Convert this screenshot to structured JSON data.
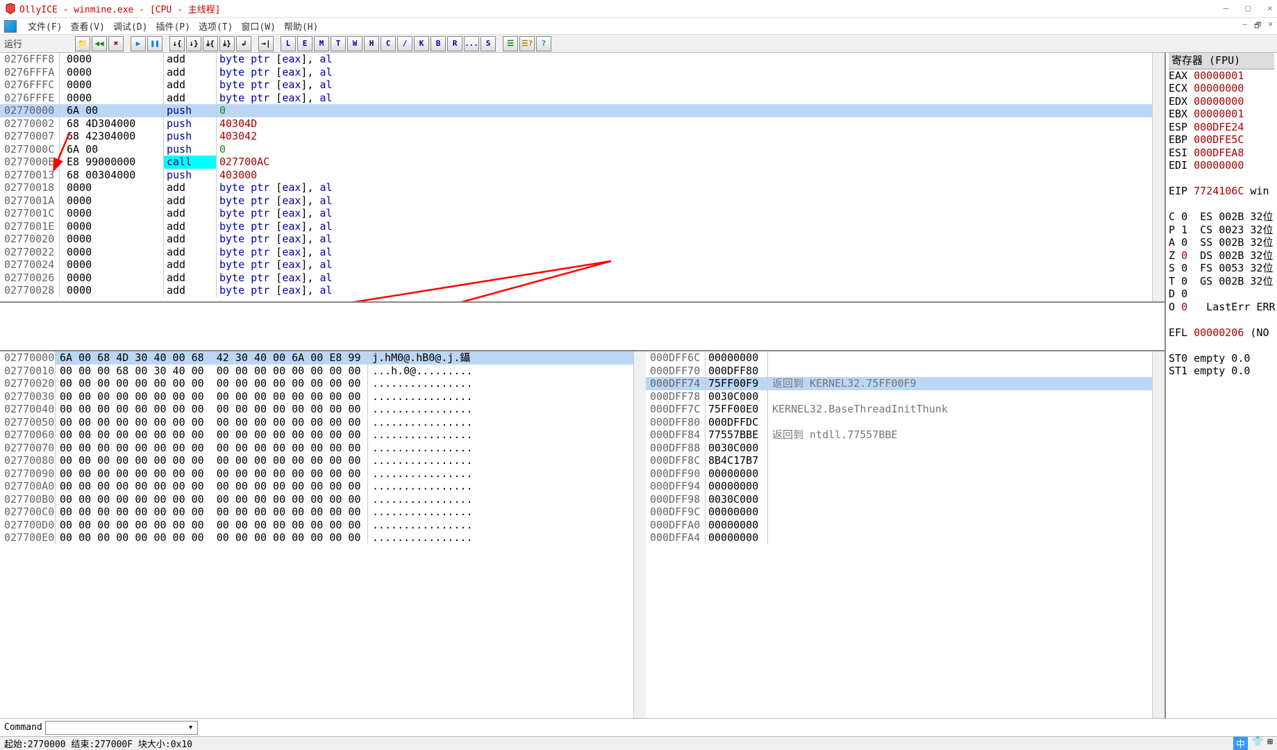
{
  "window": {
    "title": "OllyICE - winmine.exe - [CPU - 主线程]"
  },
  "menus": [
    "文件(F)",
    "查看(V)",
    "调试(D)",
    "插件(P)",
    "选项(T)",
    "窗口(W)",
    "帮助(H)"
  ],
  "run_label": "运行",
  "tool_letters": [
    "L",
    "E",
    "M",
    "T",
    "W",
    "H",
    "C",
    "/",
    "K",
    "B",
    "R",
    "...",
    "S"
  ],
  "cpu_rows": [
    {
      "addr": "0276FFF8",
      "hex": "0000",
      "mnem": "add",
      "mclass": "",
      "op": "byte ptr [eax], al"
    },
    {
      "addr": "0276FFFA",
      "hex": "0000",
      "mnem": "add",
      "mclass": "",
      "op": "byte ptr [eax], al"
    },
    {
      "addr": "0276FFFC",
      "hex": "0000",
      "mnem": "add",
      "mclass": "",
      "op": "byte ptr [eax], al"
    },
    {
      "addr": "0276FFFE",
      "hex": "0000",
      "mnem": "add",
      "mclass": "",
      "op": "byte ptr [eax], al"
    },
    {
      "addr": "02770000",
      "hex": "6A 00",
      "mnem": "push",
      "mclass": "mblue",
      "op": "0",
      "sel": true,
      "opclass": "op-green"
    },
    {
      "addr": "02770002",
      "hex": "68 4D304000",
      "mnem": "push",
      "mclass": "mblue",
      "op": "40304D",
      "opclass": "op-red"
    },
    {
      "addr": "02770007",
      "hex": "68 42304000",
      "mnem": "push",
      "mclass": "mblue",
      "op": "403042",
      "opclass": "op-red"
    },
    {
      "addr": "0277000C",
      "hex": "6A 00",
      "mnem": "push",
      "mclass": "mblue",
      "op": "0",
      "opclass": "op-green"
    },
    {
      "addr": "0277000E",
      "hex": "E8 99000000",
      "mnem": "call",
      "mclass": "mcall",
      "op": "027700AC",
      "opclass": "op-red"
    },
    {
      "addr": "02770013",
      "hex": "68 00304000",
      "mnem": "push",
      "mclass": "mblue",
      "op": "403000",
      "opclass": "op-red"
    },
    {
      "addr": "02770018",
      "hex": "0000",
      "mnem": "add",
      "mclass": "",
      "op": "byte ptr [eax], al"
    },
    {
      "addr": "0277001A",
      "hex": "0000",
      "mnem": "add",
      "mclass": "",
      "op": "byte ptr [eax], al"
    },
    {
      "addr": "0277001C",
      "hex": "0000",
      "mnem": "add",
      "mclass": "",
      "op": "byte ptr [eax], al"
    },
    {
      "addr": "0277001E",
      "hex": "0000",
      "mnem": "add",
      "mclass": "",
      "op": "byte ptr [eax], al"
    },
    {
      "addr": "02770020",
      "hex": "0000",
      "mnem": "add",
      "mclass": "",
      "op": "byte ptr [eax], al"
    },
    {
      "addr": "02770022",
      "hex": "0000",
      "mnem": "add",
      "mclass": "",
      "op": "byte ptr [eax], al"
    },
    {
      "addr": "02770024",
      "hex": "0000",
      "mnem": "add",
      "mclass": "",
      "op": "byte ptr [eax], al"
    },
    {
      "addr": "02770026",
      "hex": "0000",
      "mnem": "add",
      "mclass": "",
      "op": "byte ptr [eax], al"
    },
    {
      "addr": "02770028",
      "hex": "0000",
      "mnem": "add",
      "mclass": "",
      "op": "byte ptr [eax], al"
    }
  ],
  "dump_rows": [
    {
      "addr": "02770000",
      "hex": "6A 00 68 4D 30 40 00 68  42 30 40 00 6A 00 E8 99",
      "asc": "j.hM0@.hB0@.j.鑷",
      "sel": true
    },
    {
      "addr": "02770010",
      "hex": "00 00 00 68 00 30 40 00  00 00 00 00 00 00 00 00",
      "asc": "...h.0@........."
    },
    {
      "addr": "02770020",
      "hex": "00 00 00 00 00 00 00 00  00 00 00 00 00 00 00 00",
      "asc": "................"
    },
    {
      "addr": "02770030",
      "hex": "00 00 00 00 00 00 00 00  00 00 00 00 00 00 00 00",
      "asc": "................"
    },
    {
      "addr": "02770040",
      "hex": "00 00 00 00 00 00 00 00  00 00 00 00 00 00 00 00",
      "asc": "................"
    },
    {
      "addr": "02770050",
      "hex": "00 00 00 00 00 00 00 00  00 00 00 00 00 00 00 00",
      "asc": "................"
    },
    {
      "addr": "02770060",
      "hex": "00 00 00 00 00 00 00 00  00 00 00 00 00 00 00 00",
      "asc": "................"
    },
    {
      "addr": "02770070",
      "hex": "00 00 00 00 00 00 00 00  00 00 00 00 00 00 00 00",
      "asc": "................"
    },
    {
      "addr": "02770080",
      "hex": "00 00 00 00 00 00 00 00  00 00 00 00 00 00 00 00",
      "asc": "................"
    },
    {
      "addr": "02770090",
      "hex": "00 00 00 00 00 00 00 00  00 00 00 00 00 00 00 00",
      "asc": "................"
    },
    {
      "addr": "027700A0",
      "hex": "00 00 00 00 00 00 00 00  00 00 00 00 00 00 00 00",
      "asc": "................"
    },
    {
      "addr": "027700B0",
      "hex": "00 00 00 00 00 00 00 00  00 00 00 00 00 00 00 00",
      "asc": "................"
    },
    {
      "addr": "027700C0",
      "hex": "00 00 00 00 00 00 00 00  00 00 00 00 00 00 00 00",
      "asc": "................"
    },
    {
      "addr": "027700D0",
      "hex": "00 00 00 00 00 00 00 00  00 00 00 00 00 00 00 00",
      "asc": "................"
    },
    {
      "addr": "027700E0",
      "hex": "00 00 00 00 00 00 00 00  00 00 00 00 00 00 00 00",
      "asc": "................"
    }
  ],
  "stack_rows": [
    {
      "addr": "000DFF6C",
      "val": "00000000",
      "info": ""
    },
    {
      "addr": "000DFF70",
      "val": "000DFF80",
      "info": ""
    },
    {
      "addr": "000DFF74",
      "val": "75FF00F9",
      "info": "返回到 KERNEL32.75FF00F9",
      "sel": true
    },
    {
      "addr": "000DFF78",
      "val": "0030C000",
      "info": ""
    },
    {
      "addr": "000DFF7C",
      "val": "75FF00E0",
      "info": "KERNEL32.BaseThreadInitThunk"
    },
    {
      "addr": "000DFF80",
      "val": "000DFFDC",
      "info": ""
    },
    {
      "addr": "000DFF84",
      "val": "77557BBE",
      "info": "返回到 ntdll.77557BBE"
    },
    {
      "addr": "000DFF88",
      "val": "0030C000",
      "info": ""
    },
    {
      "addr": "000DFF8C",
      "val": "8B4C17B7",
      "info": ""
    },
    {
      "addr": "000DFF90",
      "val": "00000000",
      "info": ""
    },
    {
      "addr": "000DFF94",
      "val": "00000000",
      "info": ""
    },
    {
      "addr": "000DFF98",
      "val": "0030C000",
      "info": ""
    },
    {
      "addr": "000DFF9C",
      "val": "00000000",
      "info": ""
    },
    {
      "addr": "000DFFA0",
      "val": "00000000",
      "info": ""
    },
    {
      "addr": "000DFFA4",
      "val": "00000000",
      "info": ""
    }
  ],
  "regs_title": "寄存器 (FPU)",
  "regs": [
    {
      "n": "EAX",
      "v": "00000001",
      "r": true
    },
    {
      "n": "ECX",
      "v": "00000000",
      "r": true
    },
    {
      "n": "EDX",
      "v": "00000000",
      "r": true
    },
    {
      "n": "EBX",
      "v": "00000001",
      "r": true
    },
    {
      "n": "ESP",
      "v": "000DFE24",
      "r": true
    },
    {
      "n": "EBP",
      "v": "000DFE5C",
      "r": true
    },
    {
      "n": "ESI",
      "v": "000DFEA8",
      "r": true
    },
    {
      "n": "EDI",
      "v": "00000000",
      "r": true
    }
  ],
  "eip": {
    "n": "EIP",
    "v": "7724106C",
    "extra": "win"
  },
  "flags": [
    {
      "n": "C",
      "v": "0",
      "seg": "ES",
      "sv": "002B",
      "bits": "32位"
    },
    {
      "n": "P",
      "v": "1",
      "seg": "CS",
      "sv": "0023",
      "bits": "32位"
    },
    {
      "n": "A",
      "v": "0",
      "seg": "SS",
      "sv": "002B",
      "bits": "32位"
    },
    {
      "n": "Z",
      "v": "0",
      "seg": "DS",
      "sv": "002B",
      "bits": "32位",
      "r": true
    },
    {
      "n": "S",
      "v": "0",
      "seg": "FS",
      "sv": "0053",
      "bits": "32位"
    },
    {
      "n": "T",
      "v": "0",
      "seg": "GS",
      "sv": "002B",
      "bits": "32位"
    },
    {
      "n": "D",
      "v": "0",
      "seg": "",
      "sv": "",
      "bits": ""
    },
    {
      "n": "O",
      "v": "0",
      "seg": "",
      "sv": "LastErr",
      "bits": "ERR",
      "r": true
    }
  ],
  "efl": {
    "n": "EFL",
    "v": "00000206",
    "extra": "(NO"
  },
  "st": [
    {
      "n": "ST0",
      "v": "empty 0.0"
    },
    {
      "n": "ST1",
      "v": "empty 0.0"
    }
  ],
  "cmd_label": "Command",
  "status": "起始:2770000  结束:277000F  块大小:0x10",
  "ime": "中"
}
